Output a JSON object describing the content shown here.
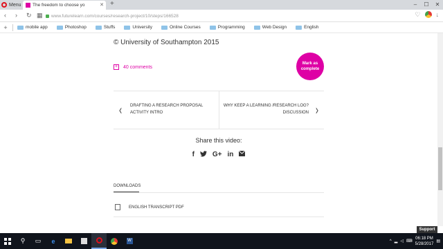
{
  "browser": {
    "menu_label": "Menu",
    "tab_title": "The freedom to choose yo",
    "url": "www.futurelearn.com/courses/research-project/10/steps/166528",
    "bookmarks": [
      "mobile app",
      "Photoshop",
      "Stuffs",
      "University",
      "Online Courses",
      "Programming",
      "Web Design",
      "English"
    ]
  },
  "page": {
    "copyright": "© University of Southampton 2015",
    "comments": "40 comments",
    "mark_complete": "Mark as complete",
    "prev_step_title": "DRAFTING A RESEARCH PROPOSAL",
    "prev_step_sub": "ACTIVITY INTRO",
    "next_step_title": "WHY KEEP A LEARNING /RESEARCH LOG?",
    "next_step_sub": "DISCUSSION",
    "share_label": "Share this video:",
    "share_icons": {
      "facebook": "f",
      "google": "G+",
      "linkedin": "in"
    },
    "downloads_label": "DOWNLOADS",
    "transcript": "ENGLISH TRANSCRIPT PDF",
    "support": "Support"
  },
  "taskbar": {
    "time": "06:18 PM",
    "date": "5/28/2017"
  },
  "colors": {
    "accent": "#de00a5",
    "taskbar": "#10141c"
  }
}
